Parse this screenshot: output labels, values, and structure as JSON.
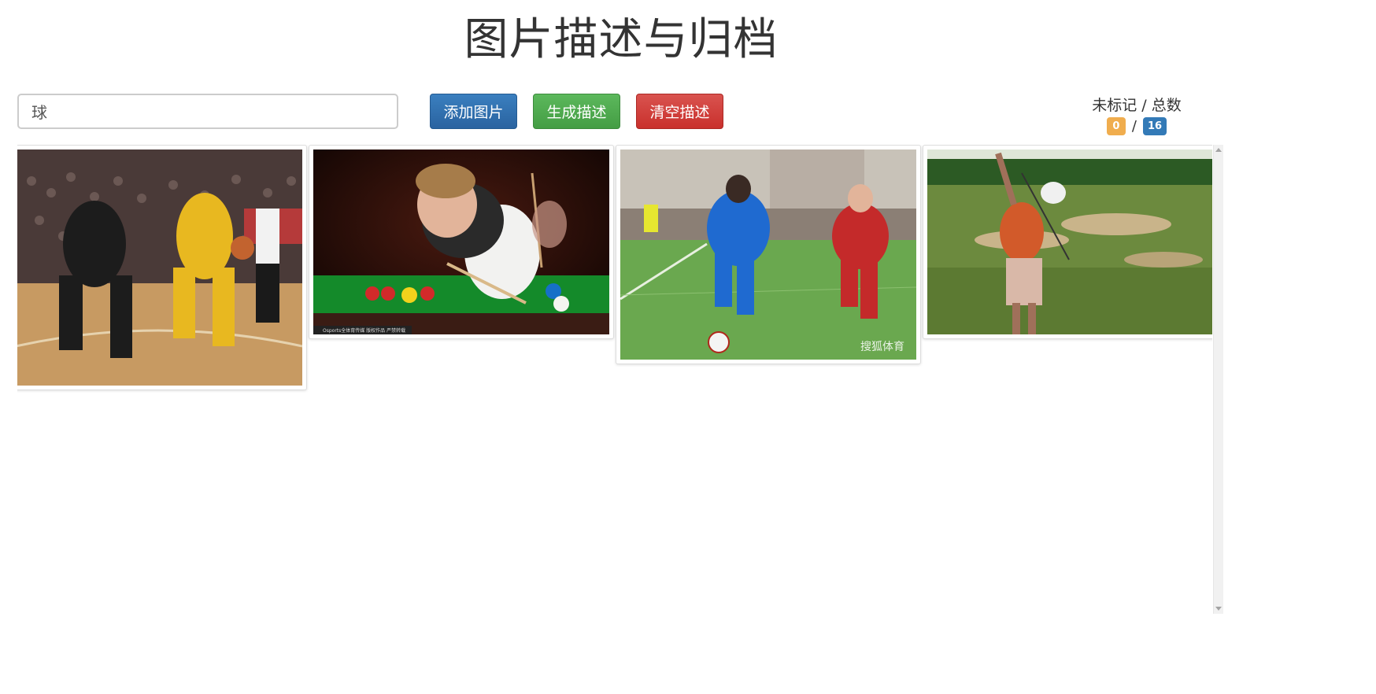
{
  "header": {
    "title": "图片描述与归档"
  },
  "search": {
    "value": "球"
  },
  "toolbar": {
    "add_label": "添加图片",
    "generate_label": "生成描述",
    "clear_label": "清空描述"
  },
  "counter": {
    "label": "未标记 / 总数",
    "unmarked": "0",
    "separator": "/",
    "total": "16"
  },
  "gallery": {
    "images": [
      {
        "subject": "basketball"
      },
      {
        "subject": "snooker",
        "caption": "Osports全体育传媒 版权作品 严禁转载"
      },
      {
        "subject": "soccer",
        "watermark": "搜狐体育"
      },
      {
        "subject": "golf"
      }
    ]
  },
  "colors": {
    "primary": "#2a63a0",
    "success": "#449d44",
    "danger": "#c9302c",
    "badge_warning": "#f0ad4e",
    "badge_info": "#337ab7"
  }
}
